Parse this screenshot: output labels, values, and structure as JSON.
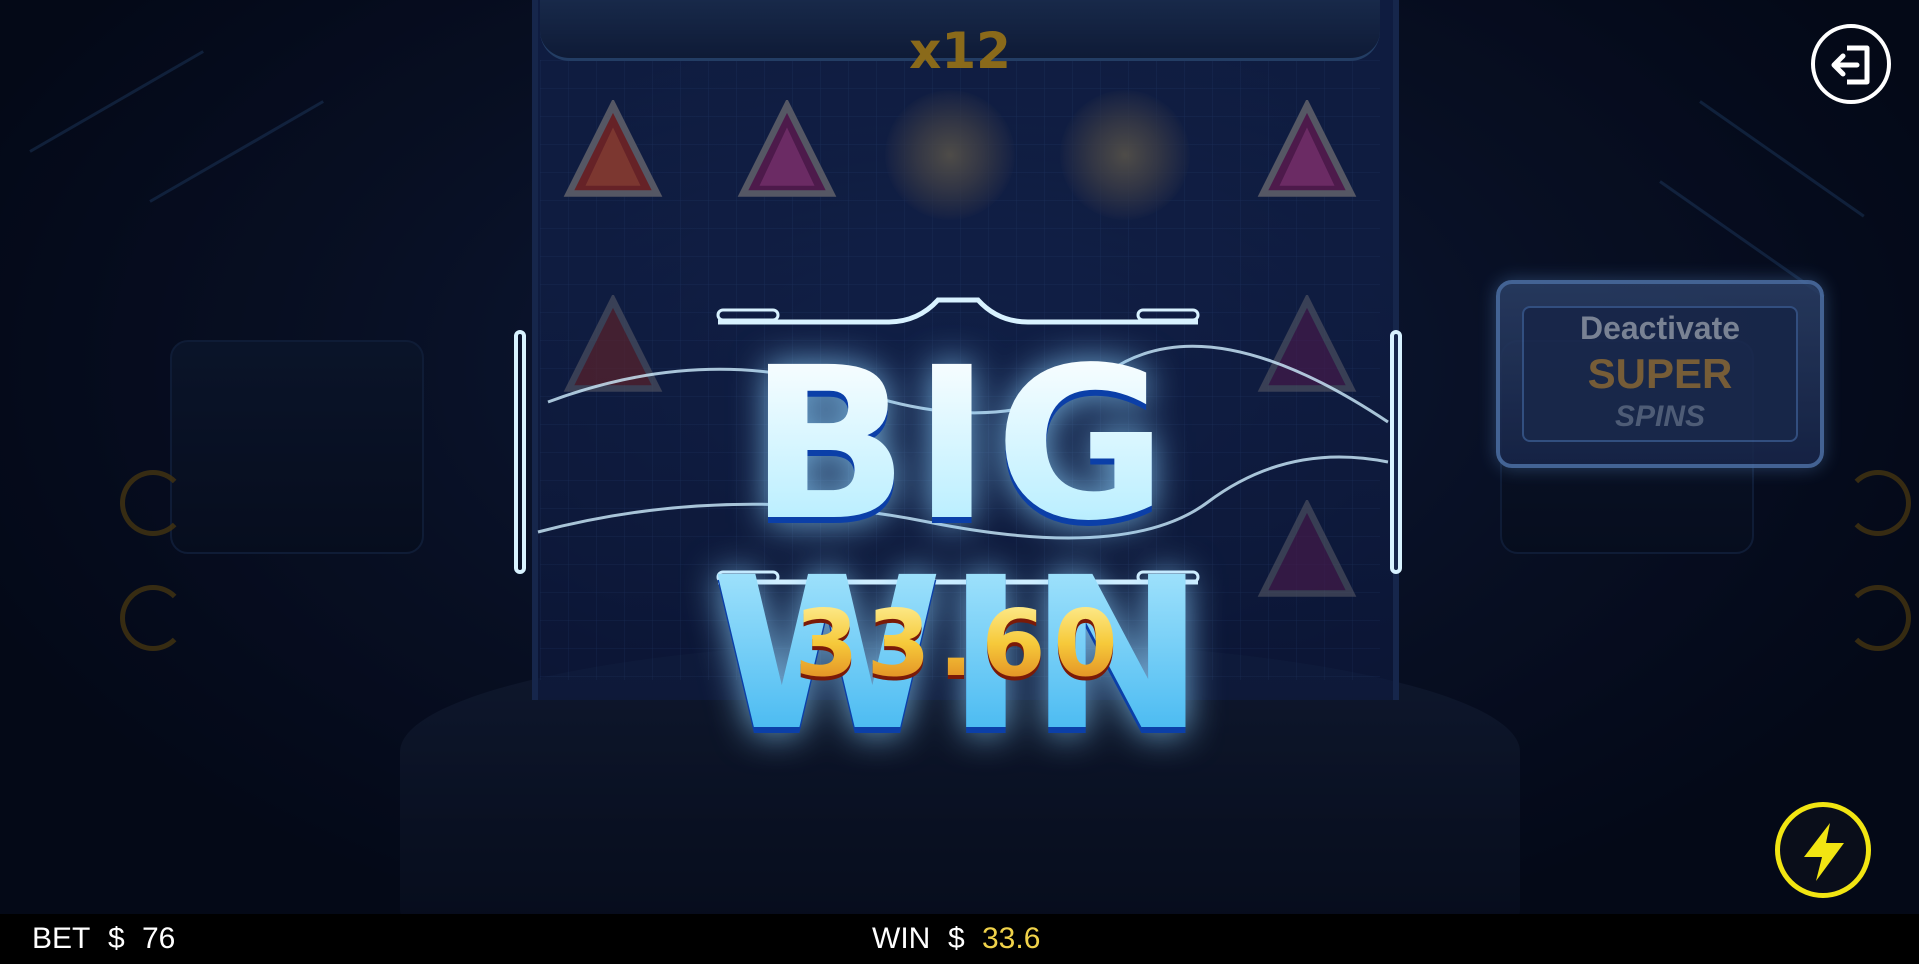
{
  "multiplier": "x12",
  "big_win": {
    "title": "BIG WIN",
    "amount": "33.60"
  },
  "super_spins_button": {
    "line1": "Deactivate",
    "line2": "SUPER",
    "line3": "SPINS"
  },
  "bottom_bar": {
    "bet_label": "BET",
    "bet_currency": "$",
    "bet_value": "76",
    "win_label": "WIN",
    "win_currency": "$",
    "win_value": "33.6"
  },
  "icons": {
    "exit": "exit-icon",
    "turbo": "lightning-icon"
  },
  "colors": {
    "win_value": "#f0d24a",
    "turbo_ring": "#f2e512",
    "big_win_text": "#aee8ff"
  }
}
